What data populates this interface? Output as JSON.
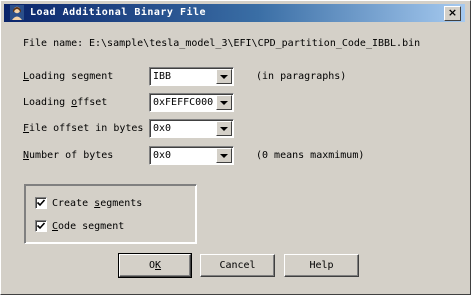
{
  "window": {
    "title": "Load Additional Binary File",
    "close_glyph": "×"
  },
  "file_name": {
    "label": "File name:",
    "value": "E:\\sample\\tesla_model_3\\EFI\\CPD_partition_Code_IBBL.bin"
  },
  "fields": {
    "loading_segment": {
      "label_hot": "L",
      "label_rest": "oading segment",
      "value": "IBB",
      "hint": "(in paragraphs)"
    },
    "loading_offset": {
      "label_pre": "Loading ",
      "label_hot": "o",
      "label_rest": "ffset",
      "value": "0xFEFFC000"
    },
    "file_offset": {
      "label_hot": "F",
      "label_rest": "ile offset in bytes",
      "value": "0x0"
    },
    "number_of_bytes": {
      "label_hot": "N",
      "label_rest": "umber of bytes",
      "value": "0x0",
      "hint": "(0 means maxmimum)"
    }
  },
  "options": {
    "create_segments": {
      "label_pre": "Create ",
      "label_hot": "s",
      "label_rest": "egments",
      "checked": true
    },
    "code_segment": {
      "label_hot": "C",
      "label_rest": "ode segment",
      "checked": true
    }
  },
  "buttons": {
    "ok": {
      "label_pre": "O",
      "label_hot": "K"
    },
    "cancel": "Cancel",
    "help": "Help"
  }
}
